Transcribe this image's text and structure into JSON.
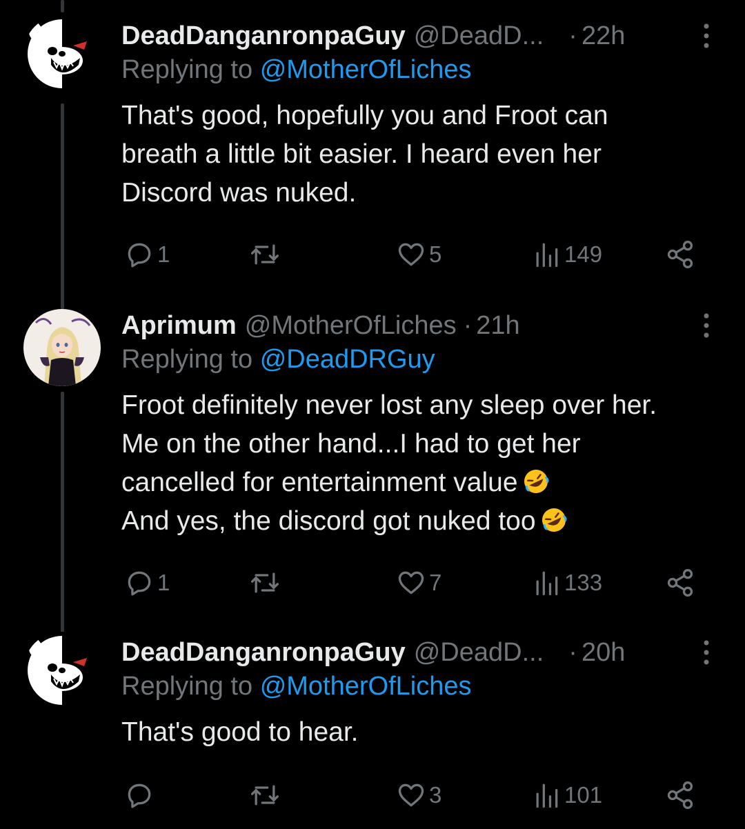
{
  "colors": {
    "background": "#000000",
    "text": "#e7e9ea",
    "muted": "#71767b",
    "link": "#1d9bf0",
    "thread_line": "#333639"
  },
  "icons": {
    "reply": "reply-icon",
    "retweet": "retweet-icon",
    "like": "heart-icon",
    "views": "views-icon",
    "share": "share-icon",
    "more": "more-icon"
  },
  "tweets": [
    {
      "name": "DeadDanganronpaGuy",
      "handle": "@DeadD...",
      "separator": "·",
      "time": "22h",
      "replying_prefix": "Replying to",
      "replying_to": "@MotherOfLiches",
      "lines": [
        "That's good, hopefully you and Froot can",
        "breath a little bit easier. I heard even her",
        "Discord was nuked."
      ],
      "replies": "1",
      "retweets": "",
      "likes": "5",
      "views": "149"
    },
    {
      "name": "Aprimum",
      "handle": "@MotherOfLiches",
      "separator": "·",
      "time": "21h",
      "replying_prefix": "Replying to",
      "replying_to": "@DeadDRGuy",
      "lines": [
        "Froot definitely never lost any sleep over her.",
        "Me on the other hand...I had to get her",
        "cancelled for entertainment value",
        "And yes, the discord got nuked too"
      ],
      "replies": "1",
      "retweets": "",
      "likes": "7",
      "views": "133"
    },
    {
      "name": "DeadDanganronpaGuy",
      "handle": "@DeadD...",
      "separator": "·",
      "time": "20h",
      "replying_prefix": "Replying to",
      "replying_to": "@MotherOfLiches",
      "lines": [
        "That's good to hear."
      ],
      "replies": "",
      "retweets": "",
      "likes": "3",
      "views": "101"
    }
  ]
}
